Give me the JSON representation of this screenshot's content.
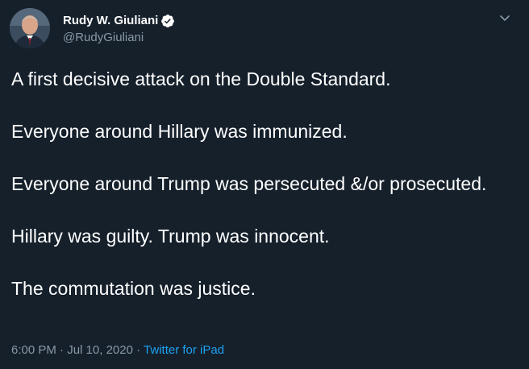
{
  "tweet": {
    "display_name": "Rudy W. Giuliani",
    "handle": "@RudyGiuliani",
    "paragraphs": [
      "A first decisive attack on the Double Standard.",
      "Everyone around Hillary was immunized.",
      "Everyone around Trump was persecuted &/or prosecuted.",
      "Hillary was guilty. Trump was innocent.",
      "The commutation was justice."
    ],
    "time": "6:00 PM",
    "separator": "·",
    "date": "Jul 10, 2020",
    "source": "Twitter for iPad"
  },
  "colors": {
    "background": "#15202b",
    "text": "#ffffff",
    "secondary_text": "#8899a6",
    "link": "#1da1f2"
  },
  "icons": {
    "verified": "verified-badge-icon",
    "caret": "chevron-down-icon"
  }
}
